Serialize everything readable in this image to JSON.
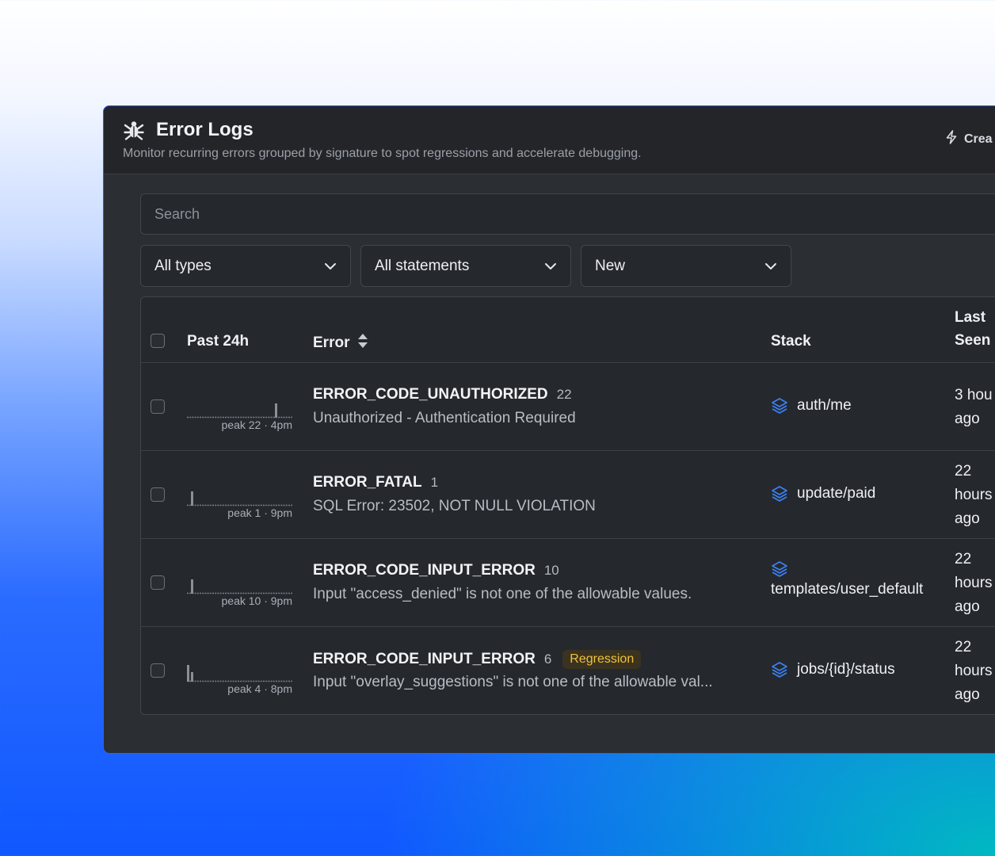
{
  "header": {
    "title": "Error Logs",
    "subtitle": "Monitor recurring errors grouped by signature to spot regressions and accelerate debugging.",
    "create_label": "Crea"
  },
  "search": {
    "placeholder": "Search"
  },
  "filters": [
    {
      "label": "All types"
    },
    {
      "label": "All statements"
    },
    {
      "label": "New"
    }
  ],
  "table": {
    "columns": {
      "past24h": "Past 24h",
      "error": "Error",
      "stack": "Stack",
      "last_seen_1": "Last",
      "last_seen_2": "Seen"
    },
    "rows": [
      {
        "peak": "peak 22 · 4pm",
        "error_code": "ERROR_CODE_UNAUTHORIZED",
        "count": "22",
        "badge": "",
        "message": "Unauthorized - Authentication Required",
        "stack": "auth/me",
        "last_seen": [
          "3 hou",
          "ago"
        ]
      },
      {
        "peak": "peak 1 · 9pm",
        "error_code": "ERROR_FATAL",
        "count": "1",
        "badge": "",
        "message": "SQL Error: 23502, NOT NULL VIOLATION",
        "stack": "update/paid",
        "last_seen": [
          "22",
          "hours",
          "ago"
        ]
      },
      {
        "peak": "peak 10 · 9pm",
        "error_code": "ERROR_CODE_INPUT_ERROR",
        "count": "10",
        "badge": "",
        "message": "Input \"access_denied\" is not one of the allowable values.",
        "stack": "templates/user_default",
        "last_seen": [
          "22",
          "hours",
          "ago"
        ]
      },
      {
        "peak": "peak 4 · 8pm",
        "error_code": "ERROR_CODE_INPUT_ERROR",
        "count": "6",
        "badge": "Regression",
        "message": "Input \"overlay_suggestions\" is not one of the allowable val...",
        "stack": "jobs/{id}/status",
        "last_seen": [
          "22",
          "hours",
          "ago"
        ]
      }
    ]
  },
  "colors": {
    "accent": "#2c5fff",
    "badge_text": "#f0c23a",
    "stack_icon": "#3b82f6"
  },
  "icons": {
    "title": "bug-icon",
    "create": "lightning-icon",
    "sort": "sort-icon",
    "stack": "layers-icon",
    "select": "chevron-down-icon"
  }
}
